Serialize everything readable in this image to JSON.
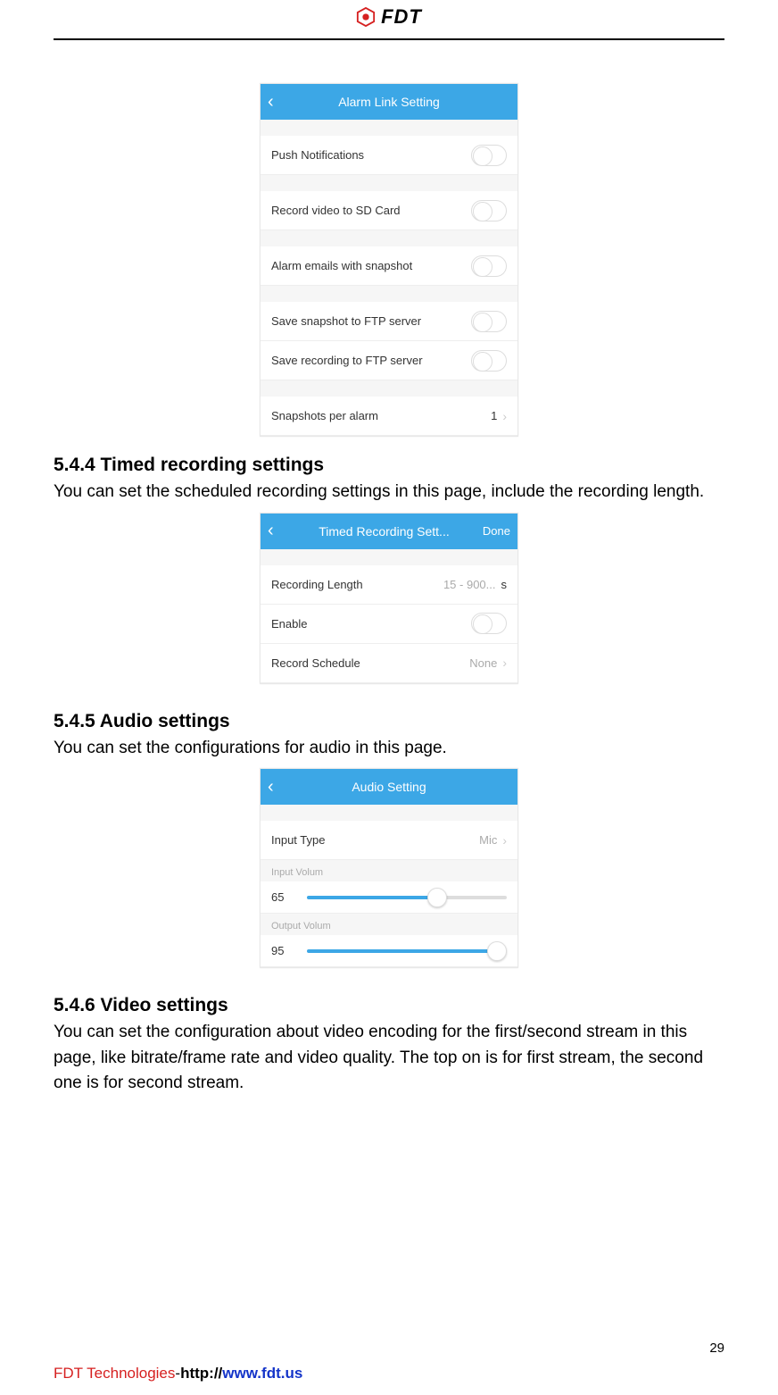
{
  "header": {
    "brand": "FDT"
  },
  "alarm": {
    "title": "Alarm Link Setting",
    "items": {
      "push": "Push Notifications",
      "record_sd": "Record video to SD Card",
      "emails": "Alarm emails with snapshot",
      "save_ftp_snap": "Save snapshot to FTP server",
      "save_ftp_rec": "Save recording to FTP server",
      "snapshots_per": "Snapshots per alarm",
      "snapshots_val": "1"
    }
  },
  "section_timed": {
    "heading": "5.4.4 Timed recording settings",
    "text": "You can set the scheduled recording settings in this page, include the recording length."
  },
  "timed": {
    "title": "Timed Recording Sett...",
    "done": "Done",
    "rec_len_label": "Recording Length",
    "rec_len_placeholder": "15 - 900...",
    "rec_len_unit": "s",
    "enable_label": "Enable",
    "schedule_label": "Record Schedule",
    "schedule_value": "None"
  },
  "section_audio": {
    "heading": "5.4.5 Audio settings",
    "text": "You can set the configurations for audio in this page."
  },
  "audio": {
    "title": "Audio Setting",
    "input_type_label": "Input Type",
    "input_type_value": "Mic",
    "input_vol_label": "Input Volum",
    "input_vol_value": "65",
    "output_vol_label": "Output Volum",
    "output_vol_value": "95"
  },
  "section_video": {
    "heading": "5.4.6 Video settings",
    "text": "You can set the configuration about video encoding for the first/second stream in this page, like bitrate/frame rate and video quality. The top on is for first stream, the second one is for second stream."
  },
  "footer": {
    "page": "29",
    "company": "FDT Technologies",
    "dash": "-",
    "url_proto": "http://",
    "url_domain": "www.fdt.us"
  }
}
